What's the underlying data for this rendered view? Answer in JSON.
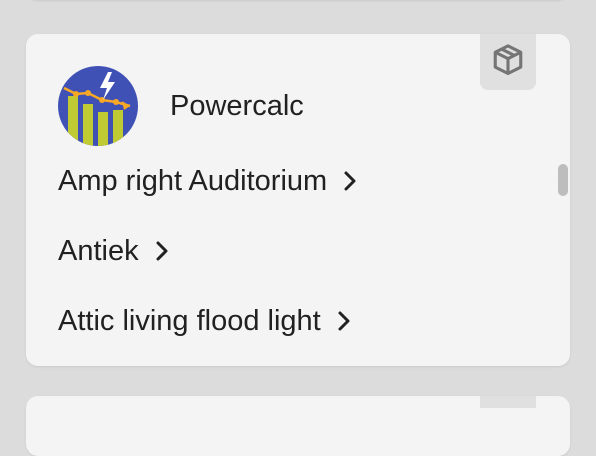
{
  "integration": {
    "title": "Powercalc",
    "badge_icon": "package-box-icon",
    "logo_icon": "powercalc-logo-icon"
  },
  "entries": [
    {
      "label": "Amp right Auditorium",
      "icon": "chevron-right-icon"
    },
    {
      "label": "Antiek",
      "icon": "chevron-right-icon"
    },
    {
      "label": "Attic living flood light",
      "icon": "chevron-right-icon"
    }
  ],
  "colors": {
    "page_background": "#dcdcdc",
    "card_background": "#f4f4f4",
    "badge_background": "#e0e0e0",
    "text": "#212121",
    "logo_blue": "#3f51b5",
    "logo_bars": "#c0ca33",
    "logo_line": "#f9a825"
  }
}
